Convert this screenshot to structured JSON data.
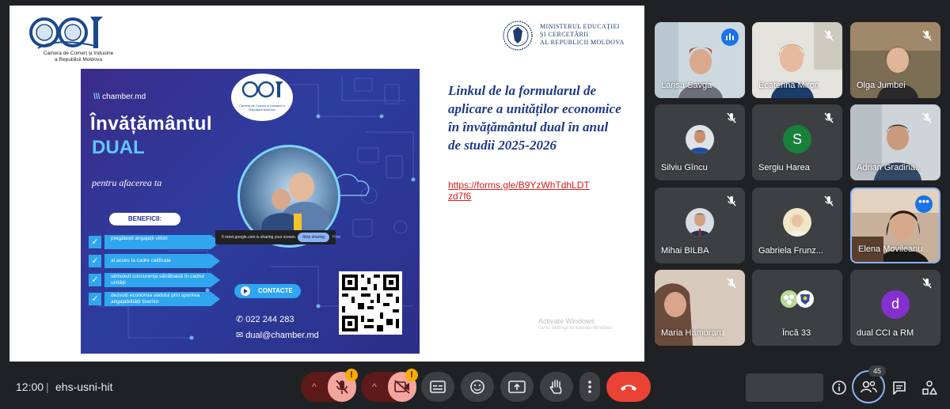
{
  "presentation": {
    "cci_logo_text": "CCI",
    "cci_caption_line1": "Camera de Comerț și Industrie",
    "cci_caption_line2": "a Republicii Moldova",
    "ministry_line1": "MINISTERUL EDUCAȚIEI",
    "ministry_line2": "ȘI CERCETĂRII",
    "ministry_line3": "AL REPUBLICII MOLDOVA",
    "poster": {
      "brand": "chamber.md",
      "badge_caption": "Camera de Comerț și Industrie a Republicii Moldova",
      "title_line1": "Învățământul",
      "title_line2": "DUAL",
      "subtitle": "pentru afacerea ta",
      "benefits_title": "BENEFICII:",
      "benefits": [
        "pregătești angajații viitori",
        "ai acces la cadre calificate",
        "stimulezi concurența sănătoasă în cadrul unității",
        "dezvolți economia statului prin sporirea angajabilității tinerilor"
      ],
      "contact_label": "CONTACTE",
      "phone": "022 244 283",
      "email": "dual@chamber.md"
    },
    "share_banner": {
      "text": "meet.google.com is sharing your screen.",
      "stop_label": "Stop sharing",
      "hide_label": "Hide"
    },
    "link_heading": "Linkul de la formularul de aplicare  a unităților economice în învățământul dual în anul de studii 2025-2026",
    "link_url": "https://forms.gle/B9YzWhTdhLDTzd7f6",
    "watermark_line1": "Activate Windows",
    "watermark_line2": "Go to Settings to activate Windows."
  },
  "participants": [
    {
      "name": "Larisa Savga",
      "state": "speaking"
    },
    {
      "name": "Ecaterina Miron",
      "state": "muted"
    },
    {
      "name": "Olga Jumbei",
      "state": "muted"
    },
    {
      "name": "Silviu Gîncu",
      "state": "muted"
    },
    {
      "name": "Sergiu Harea",
      "state": "muted",
      "initial": "S",
      "color": "#188038"
    },
    {
      "name": "Adrian Gradina...",
      "state": "muted"
    },
    {
      "name": "Mihai BILBA",
      "state": "muted"
    },
    {
      "name": "Gabriela Frunz...",
      "state": "muted"
    },
    {
      "name": "Elena Movileanu",
      "state": "menu"
    },
    {
      "name": "Maria Hamuraru",
      "state": "muted"
    },
    {
      "name": "Încă 33",
      "state": "more"
    },
    {
      "name": "dual CCI a RM",
      "state": "muted",
      "initial": "d",
      "color": "#8430ce"
    }
  ],
  "bottom_bar": {
    "time": "12:00",
    "separator": "|",
    "meeting_code": "ehs-usni-hit",
    "people_count": "45",
    "warn_mark": "!",
    "caret": "^"
  },
  "colors": {
    "background": "#202124",
    "tile": "#3c4043",
    "accent": "#8ab4f8",
    "end_call": "#ea4335",
    "muted_controls": "#f3a59e",
    "warning": "#f9ab00"
  }
}
